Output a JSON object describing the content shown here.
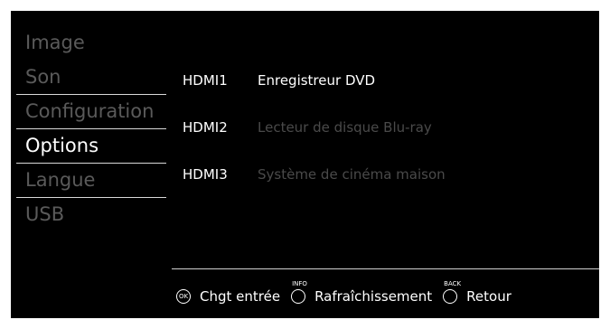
{
  "menu": {
    "items": [
      {
        "label": "Image",
        "active": false
      },
      {
        "label": "Son",
        "active": false
      },
      {
        "label": "Configuration",
        "active": false
      },
      {
        "label": "Options",
        "active": true
      },
      {
        "label": "Langue",
        "active": false
      },
      {
        "label": "USB",
        "active": false
      }
    ]
  },
  "inputs": [
    {
      "port": "HDMI1",
      "device": "Enregistreur DVD",
      "selected": true
    },
    {
      "port": "HDMI2",
      "device": "Lecteur de disque Blu-ray",
      "selected": false
    },
    {
      "port": "HDMI3",
      "device": "Système de cinéma maison",
      "selected": false
    }
  ],
  "footer": {
    "ok_button": {
      "key": "OK",
      "label": "Chgt entrée"
    },
    "info_button": {
      "key": "INFO",
      "label": "Rafraîchissement"
    },
    "back_button": {
      "key": "BACK",
      "label": "Retour"
    }
  },
  "colors": {
    "background": "#000000",
    "active_text": "#ffffff",
    "inactive_menu_text": "#5a5a5a",
    "inactive_device_text": "#4a4a4a",
    "divider": "#d9d9d9"
  }
}
